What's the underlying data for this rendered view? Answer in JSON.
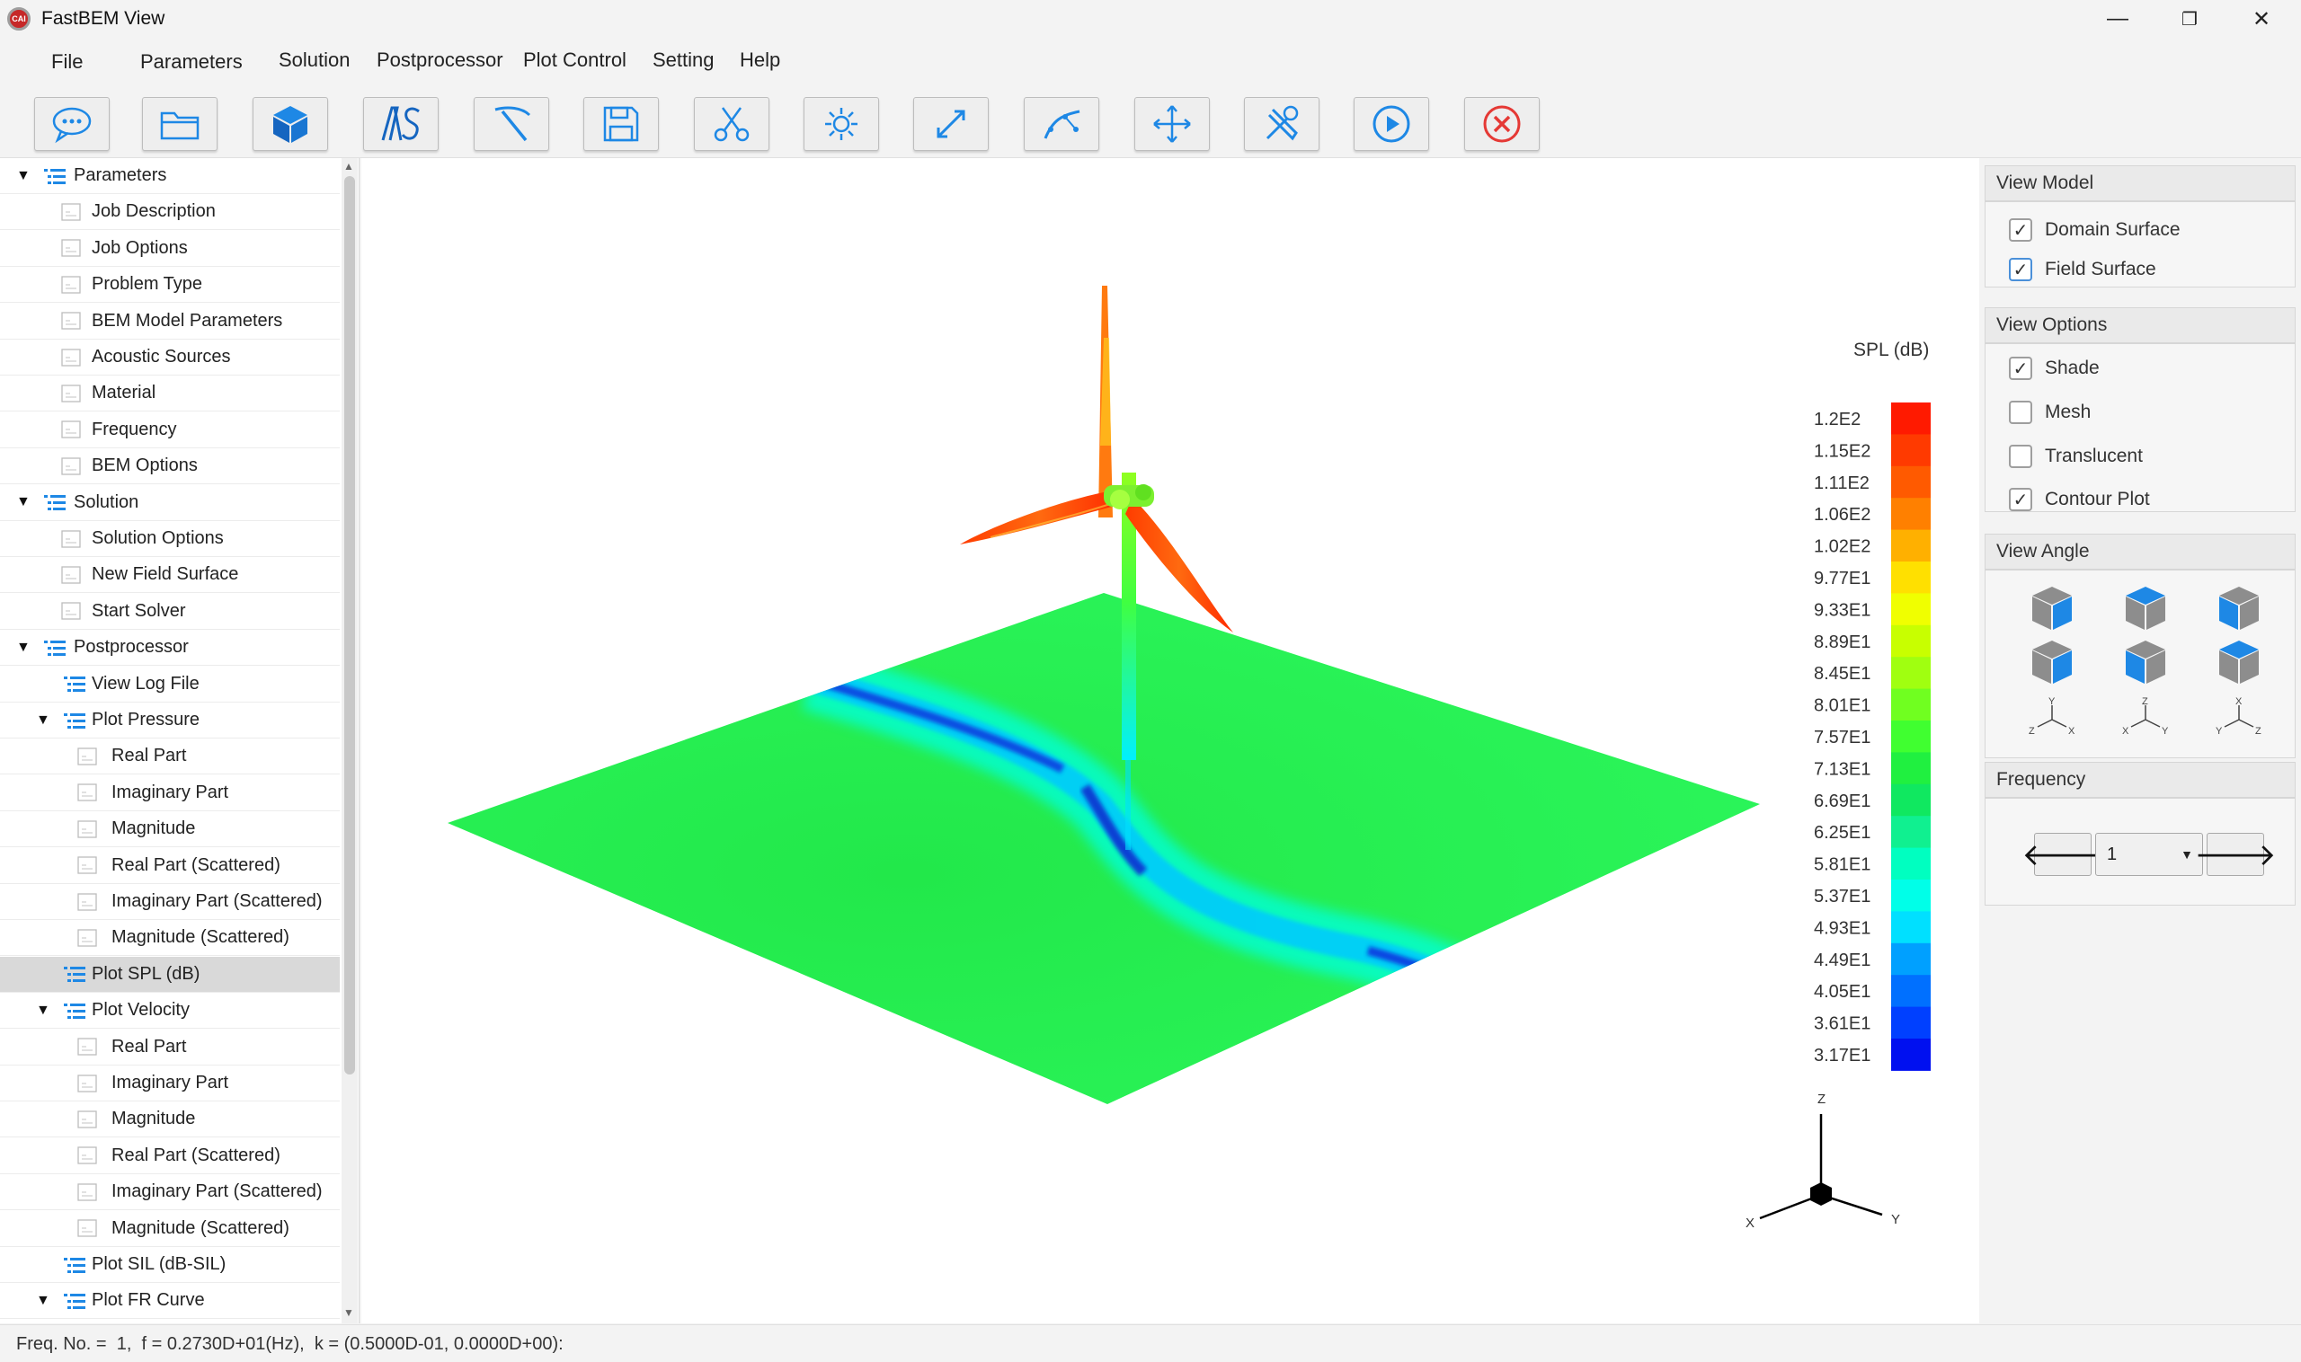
{
  "window": {
    "title": "FastBEM View",
    "logo_text": "CAI",
    "controls": {
      "minimize": "—",
      "restore": "❐",
      "close": "✕"
    }
  },
  "menu": [
    "File",
    "Parameters",
    "Solution",
    "Postprocessor",
    "Plot Control",
    "Setting",
    "Help"
  ],
  "toolbar": [
    {
      "name": "chat-icon"
    },
    {
      "name": "open-folder-icon"
    },
    {
      "name": "model-cube-icon"
    },
    {
      "name": "as-logo-icon"
    },
    {
      "name": "pick-tool-icon"
    },
    {
      "name": "save-icon"
    },
    {
      "name": "cut-icon"
    },
    {
      "name": "light-icon"
    },
    {
      "name": "fit-expand-icon"
    },
    {
      "name": "curve-icon"
    },
    {
      "name": "move-icon"
    },
    {
      "name": "tools-icon"
    },
    {
      "name": "run-play-icon"
    },
    {
      "name": "exit-close-icon"
    }
  ],
  "tree": [
    {
      "label": "Parameters",
      "level": 0,
      "kind": "group",
      "expanded": true
    },
    {
      "label": "Job Description",
      "level": 1,
      "kind": "leaf"
    },
    {
      "label": "Job Options",
      "level": 1,
      "kind": "leaf"
    },
    {
      "label": "Problem Type",
      "level": 1,
      "kind": "leaf"
    },
    {
      "label": "BEM Model Parameters",
      "level": 1,
      "kind": "leaf"
    },
    {
      "label": "Acoustic Sources",
      "level": 1,
      "kind": "leaf"
    },
    {
      "label": "Material",
      "level": 1,
      "kind": "leaf"
    },
    {
      "label": "Frequency",
      "level": 1,
      "kind": "leaf"
    },
    {
      "label": "BEM Options",
      "level": 1,
      "kind": "leaf"
    },
    {
      "label": "Solution",
      "level": 0,
      "kind": "group",
      "expanded": true
    },
    {
      "label": "Solution Options",
      "level": 1,
      "kind": "leaf"
    },
    {
      "label": "New Field Surface",
      "level": 1,
      "kind": "leaf"
    },
    {
      "label": "Start Solver",
      "level": 1,
      "kind": "leaf"
    },
    {
      "label": "Postprocessor",
      "level": 0,
      "kind": "group",
      "expanded": true
    },
    {
      "label": "View Log File",
      "level": 1,
      "kind": "list"
    },
    {
      "label": "Plot Pressure",
      "level": 1,
      "kind": "group",
      "expanded": true
    },
    {
      "label": "Real Part",
      "level": 2,
      "kind": "leaf"
    },
    {
      "label": "Imaginary Part",
      "level": 2,
      "kind": "leaf"
    },
    {
      "label": "Magnitude",
      "level": 2,
      "kind": "leaf"
    },
    {
      "label": "Real Part (Scattered)",
      "level": 2,
      "kind": "leaf"
    },
    {
      "label": "Imaginary Part (Scattered)",
      "level": 2,
      "kind": "leaf"
    },
    {
      "label": "Magnitude (Scattered)",
      "level": 2,
      "kind": "leaf"
    },
    {
      "label": "Plot SPL (dB)",
      "level": 1,
      "kind": "list",
      "selected": true
    },
    {
      "label": "Plot Velocity",
      "level": 1,
      "kind": "group",
      "expanded": true
    },
    {
      "label": "Real Part",
      "level": 2,
      "kind": "leaf"
    },
    {
      "label": "Imaginary Part",
      "level": 2,
      "kind": "leaf"
    },
    {
      "label": "Magnitude",
      "level": 2,
      "kind": "leaf"
    },
    {
      "label": "Real Part (Scattered)",
      "level": 2,
      "kind": "leaf"
    },
    {
      "label": "Imaginary Part (Scattered)",
      "level": 2,
      "kind": "leaf"
    },
    {
      "label": "Magnitude (Scattered)",
      "level": 2,
      "kind": "leaf"
    },
    {
      "label": "Plot SIL (dB-SIL)",
      "level": 1,
      "kind": "list"
    },
    {
      "label": "Plot FR Curve",
      "level": 1,
      "kind": "group",
      "expanded": true
    }
  ],
  "legend": {
    "title": "SPL (dB)",
    "labels": [
      "1.2E2",
      "1.15E2",
      "1.11E2",
      "1.06E2",
      "1.02E2",
      "9.77E1",
      "9.33E1",
      "8.89E1",
      "8.45E1",
      "8.01E1",
      "7.57E1",
      "7.13E1",
      "6.69E1",
      "6.25E1",
      "5.81E1",
      "5.37E1",
      "4.93E1",
      "4.49E1",
      "4.05E1",
      "3.61E1",
      "3.17E1"
    ],
    "colors": [
      "#ff1a00",
      "#ff3a00",
      "#ff5a00",
      "#ff8000",
      "#ffb000",
      "#ffe000",
      "#f0ff00",
      "#c8ff00",
      "#a0ff10",
      "#70ff20",
      "#40ff30",
      "#20f040",
      "#10e860",
      "#10f090",
      "#00ffc0",
      "#00ffe8",
      "#00e0ff",
      "#00a0ff",
      "#0070ff",
      "#0040ff",
      "#0010f0"
    ]
  },
  "axes": {
    "z": "Z",
    "x": "X",
    "y": "Y"
  },
  "view_model": {
    "header": "View Model",
    "items": [
      {
        "label": "Domain Surface",
        "checked": true
      },
      {
        "label": "Field Surface",
        "checked": true
      }
    ]
  },
  "view_options": {
    "header": "View Options",
    "items": [
      {
        "label": "Shade",
        "checked": true
      },
      {
        "label": "Mesh",
        "checked": false
      },
      {
        "label": "Translucent",
        "checked": false
      },
      {
        "label": "Contour Plot",
        "checked": true
      }
    ]
  },
  "view_angle": {
    "header": "View Angle",
    "triads": [
      {
        "top": "Y",
        "left": "Z",
        "right": "X"
      },
      {
        "top": "Z",
        "left": "X",
        "right": "Y"
      },
      {
        "top": "X",
        "left": "Y",
        "right": "Z"
      }
    ]
  },
  "frequency": {
    "header": "Frequency",
    "value": "1",
    "prev": "🡐",
    "next": "🡒"
  },
  "status": "Freq. No. =  1,  f = 0.2730D+01(Hz),  k = (0.5000D-01, 0.0000D+00):"
}
